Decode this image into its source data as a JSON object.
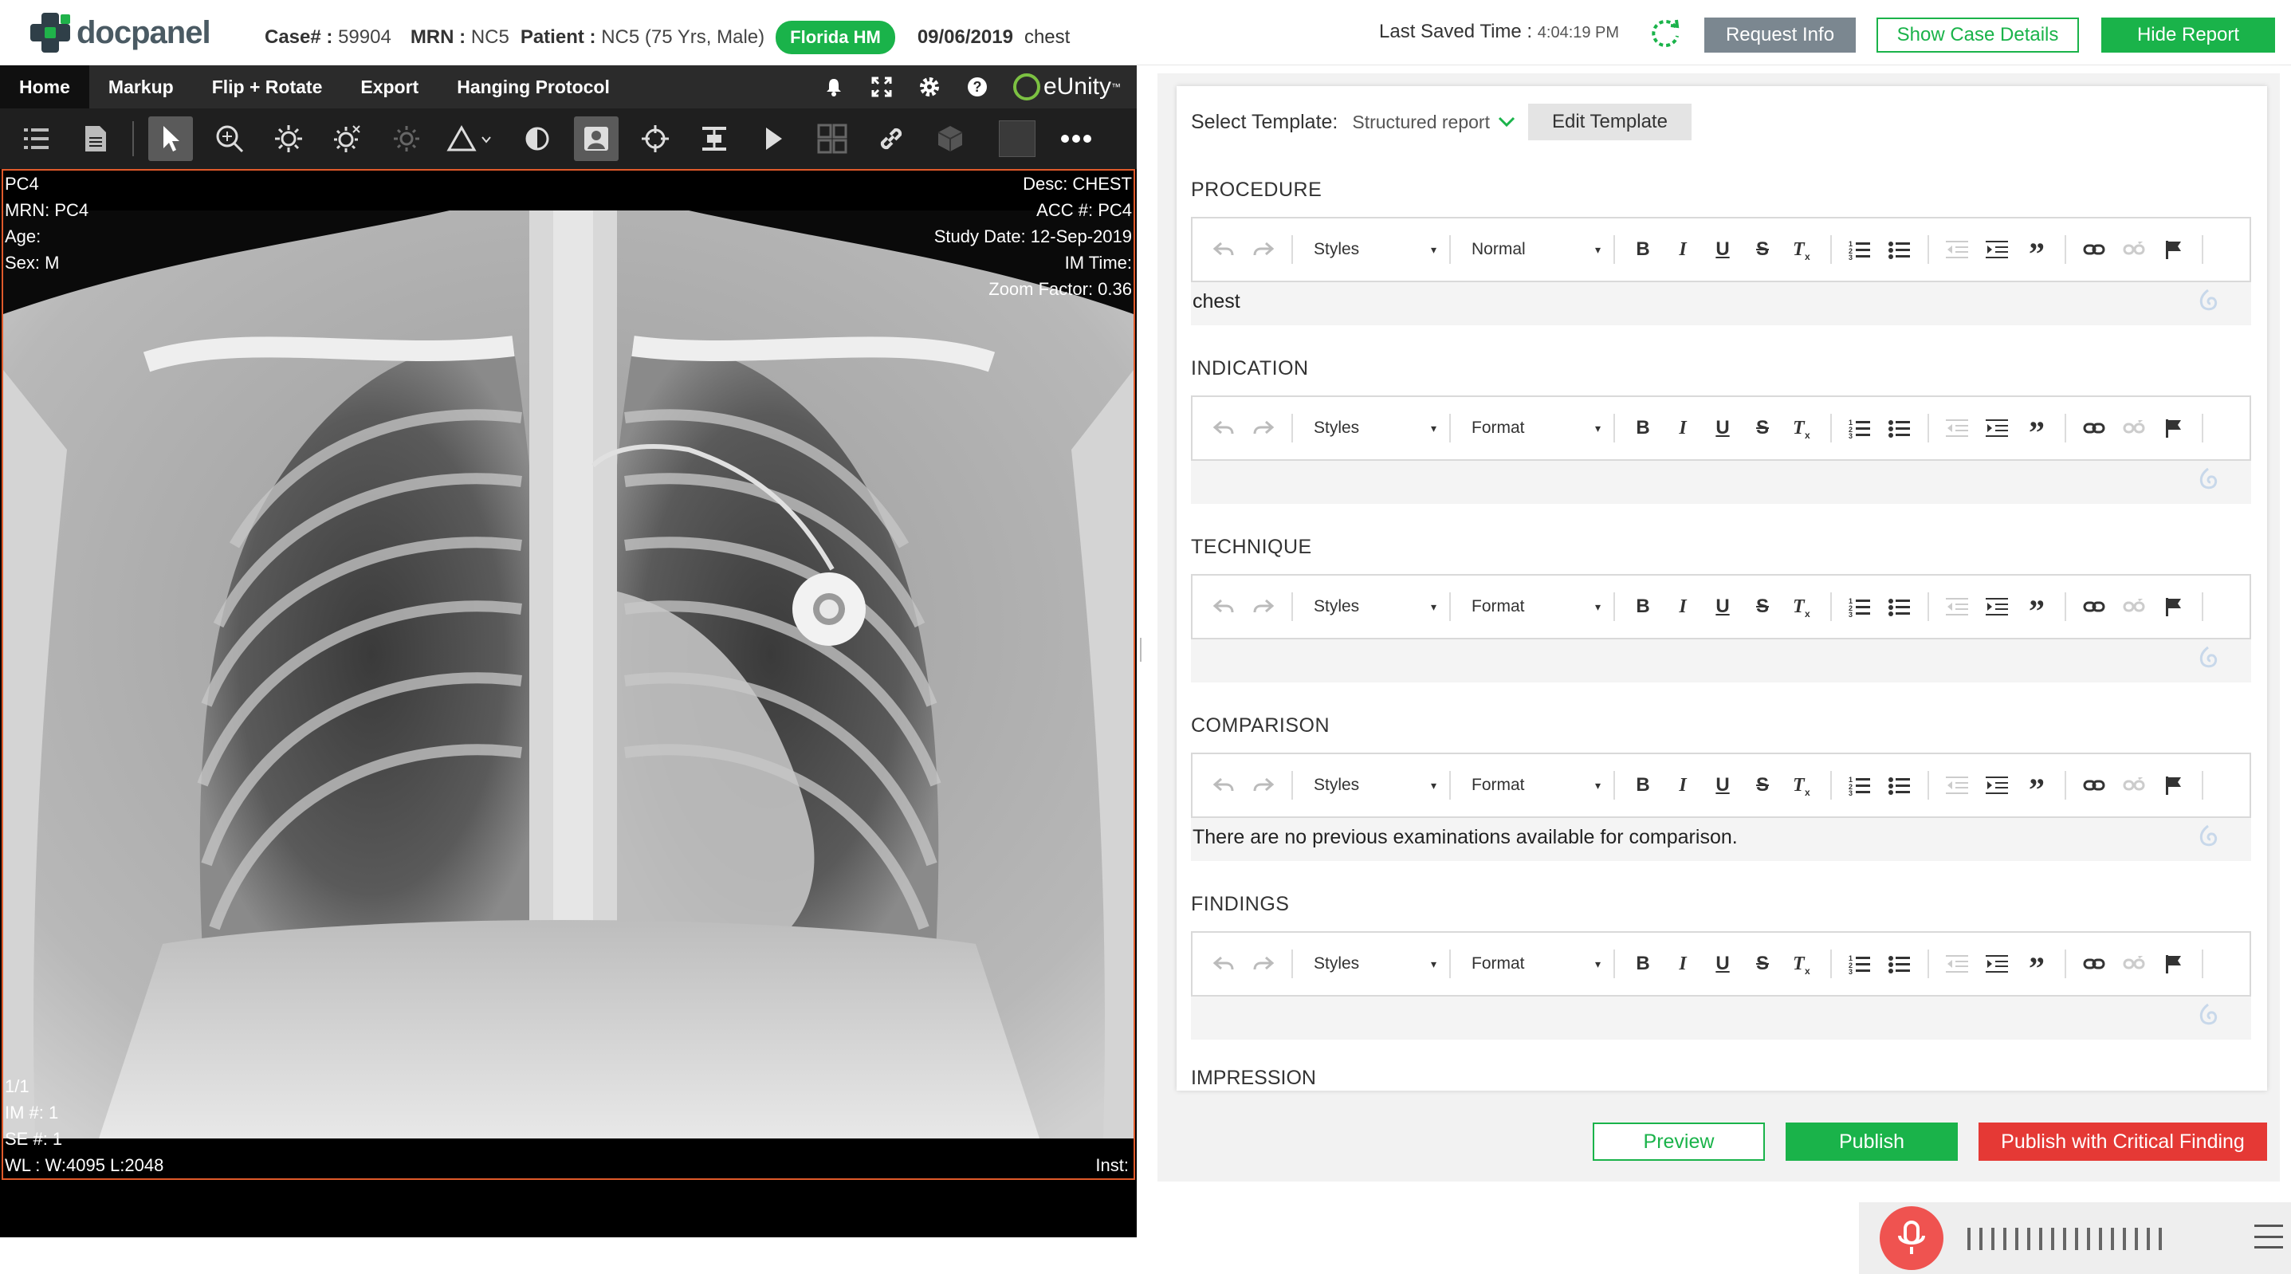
{
  "app": {
    "logo_text": "docpanel",
    "brand_green": "#1ab34a",
    "alert_red": "#e53935"
  },
  "header": {
    "case_label": "Case# :",
    "case_value": "59904",
    "mrn_label": "MRN :",
    "mrn_value": "NC5",
    "patient_label": "Patient :",
    "patient_value": "NC5 (75 Yrs, Male)",
    "facility_badge": "Florida HM",
    "date": "09/06/2019",
    "body_part": "chest",
    "last_saved_label": "Last Saved Time :",
    "last_saved_time": "4:04:19 PM",
    "request_info": "Request Info",
    "show_case_details": "Show Case Details",
    "hide_report": "Hide Report"
  },
  "viewer": {
    "menu": [
      "Home",
      "Markup",
      "Flip + Rotate",
      "Export",
      "Hanging Protocol"
    ],
    "brand": "eUnity",
    "brand_mark": "™",
    "overlay": {
      "top_left": [
        "PC4",
        "MRN: PC4",
        "Age:",
        "Sex: M"
      ],
      "top_right": [
        "Desc: CHEST",
        "ACC #: PC4",
        "Study Date: 12-Sep-2019",
        "IM Time:",
        "Zoom Factor: 0.36"
      ],
      "bottom_left": [
        "1/1",
        "IM #: 1",
        "SE #: 1",
        "WL : W:4095 L:2048"
      ],
      "bottom_right": "Inst:"
    }
  },
  "report": {
    "template_label": "Select Template:",
    "template_value": "Structured report",
    "edit_template": "Edit Template",
    "sections": [
      {
        "title": "PROCEDURE",
        "format": "Normal",
        "styles": "Styles",
        "content": "chest"
      },
      {
        "title": "INDICATION",
        "format": "Format",
        "styles": "Styles",
        "content": ""
      },
      {
        "title": "TECHNIQUE",
        "format": "Format",
        "styles": "Styles",
        "content": ""
      },
      {
        "title": "COMPARISON",
        "format": "Format",
        "styles": "Styles",
        "content": "There are no previous examinations available for comparison."
      },
      {
        "title": "FINDINGS",
        "format": "Format",
        "styles": "Styles",
        "content": ""
      }
    ],
    "next_section_cut": "IMPRESSION"
  },
  "actions": {
    "preview": "Preview",
    "publish": "Publish",
    "publish_critical": "Publish with Critical Finding"
  }
}
